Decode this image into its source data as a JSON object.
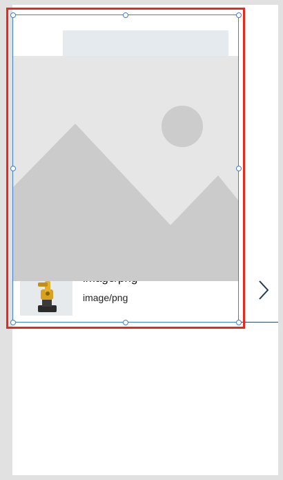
{
  "canvas": {
    "background": "#ffffff"
  },
  "gallery_item": {
    "title": "image/png",
    "subtitle": "image/png",
    "thumbnail_icon": "robot-arm-icon",
    "next_icon": "chevron-right-icon"
  },
  "image_control": {
    "placeholder_icon": "image-placeholder-icon",
    "selected": true
  },
  "colors": {
    "selection_outline": "#e8281c",
    "selection_handles": "#3d7fd0",
    "divider": "#2e4a66"
  }
}
